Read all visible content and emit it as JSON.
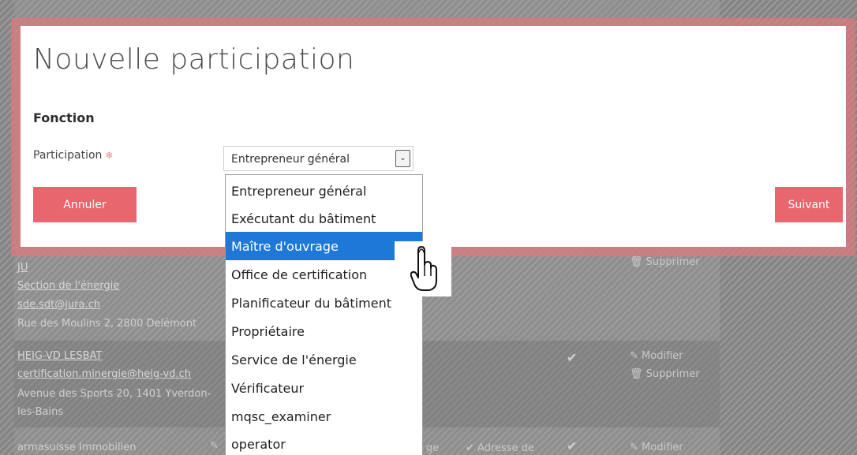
{
  "background": {
    "rows": [
      {
        "lines": [
          {
            "text": "JU",
            "link": true
          },
          {
            "text": "Section de l'énergie",
            "link": true
          },
          {
            "text": "sde.sdt@jura.ch",
            "link": true
          },
          {
            "text": "Rue des Moulins 2, 2800 Delémont",
            "link": false
          }
        ],
        "actions": [
          "Supprimer"
        ]
      },
      {
        "lines": [
          {
            "text": "HEIG-VD LESBAT",
            "link": true
          },
          {
            "text": "certification.minergie@heig-vd.ch",
            "link": true
          },
          {
            "text": "Avenue des Sports 20, 1401 Yverdon-",
            "link": false
          },
          {
            "text": "les-Bains",
            "link": false
          }
        ],
        "actions": [
          "Modifier",
          "Supprimer"
        ]
      },
      {
        "lines": [
          {
            "text": "armasuisse Immobilien",
            "link": false
          }
        ],
        "middle_text_1": "ge",
        "middle_text_2": "Adresse de",
        "actions": [
          "Modifier"
        ]
      }
    ]
  },
  "modal": {
    "title": "Nouvelle participation",
    "section_title": "Fonction",
    "field_label": "Participation",
    "required_mark": "❄",
    "select": {
      "value": "Entrepreneur général",
      "arrow": "chevron-down-icon"
    },
    "cancel_label": "Annuler",
    "next_label": "Suivant"
  },
  "dropdown": {
    "selected_index": 2,
    "options": [
      "Entrepreneur général",
      "Exécutant du bâtiment",
      "Maître d'ouvrage",
      "Office de certification",
      "Planificateur du bâtiment",
      "Propriétaire",
      "Service de l'énergie",
      "Vérificateur",
      "mqsc_examiner",
      "operator"
    ]
  },
  "colors": {
    "accent": "#e8666d",
    "selection": "#1e78d7",
    "modal_frame": "#dc787d"
  }
}
